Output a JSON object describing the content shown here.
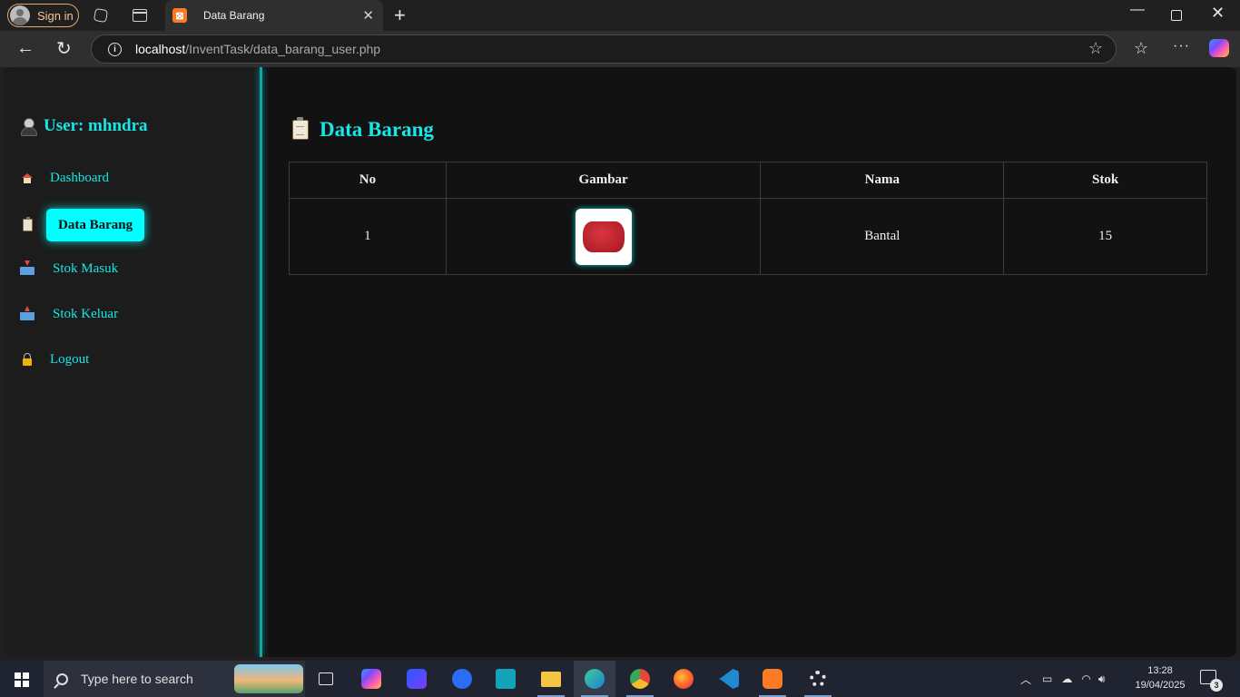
{
  "browser": {
    "signin_label": "Sign in",
    "tab_title": "Data Barang",
    "tab_favicon_letter": "⊠",
    "url_host": "localhost",
    "url_path": "/InventTask/data_barang_user.php"
  },
  "sidebar": {
    "user_label": "User: mhndra",
    "items": [
      {
        "label": "Dashboard",
        "icon": "house-icon",
        "active": false
      },
      {
        "label": "Data Barang",
        "icon": "clipboard-icon",
        "active": true
      },
      {
        "label": "Stok Masuk",
        "icon": "inbox-tray-icon",
        "active": false
      },
      {
        "label": "Stok Keluar",
        "icon": "outbox-tray-icon",
        "active": false
      },
      {
        "label": "Logout",
        "icon": "lock-icon",
        "active": false
      }
    ]
  },
  "main": {
    "title": "Data Barang",
    "table": {
      "headers": [
        "No",
        "Gambar",
        "Nama",
        "Stok"
      ],
      "rows": [
        {
          "no": "1",
          "gambar": "pillow-image",
          "nama": "Bantal",
          "stok": "15"
        }
      ]
    }
  },
  "taskbar": {
    "search_placeholder": "Type here to search",
    "time": "13:28",
    "date": "19/04/2025",
    "notification_count": "3"
  },
  "colors": {
    "accent": "#00ffff",
    "sidebar_bg": "#1c1c1c",
    "content_bg": "#121212"
  }
}
